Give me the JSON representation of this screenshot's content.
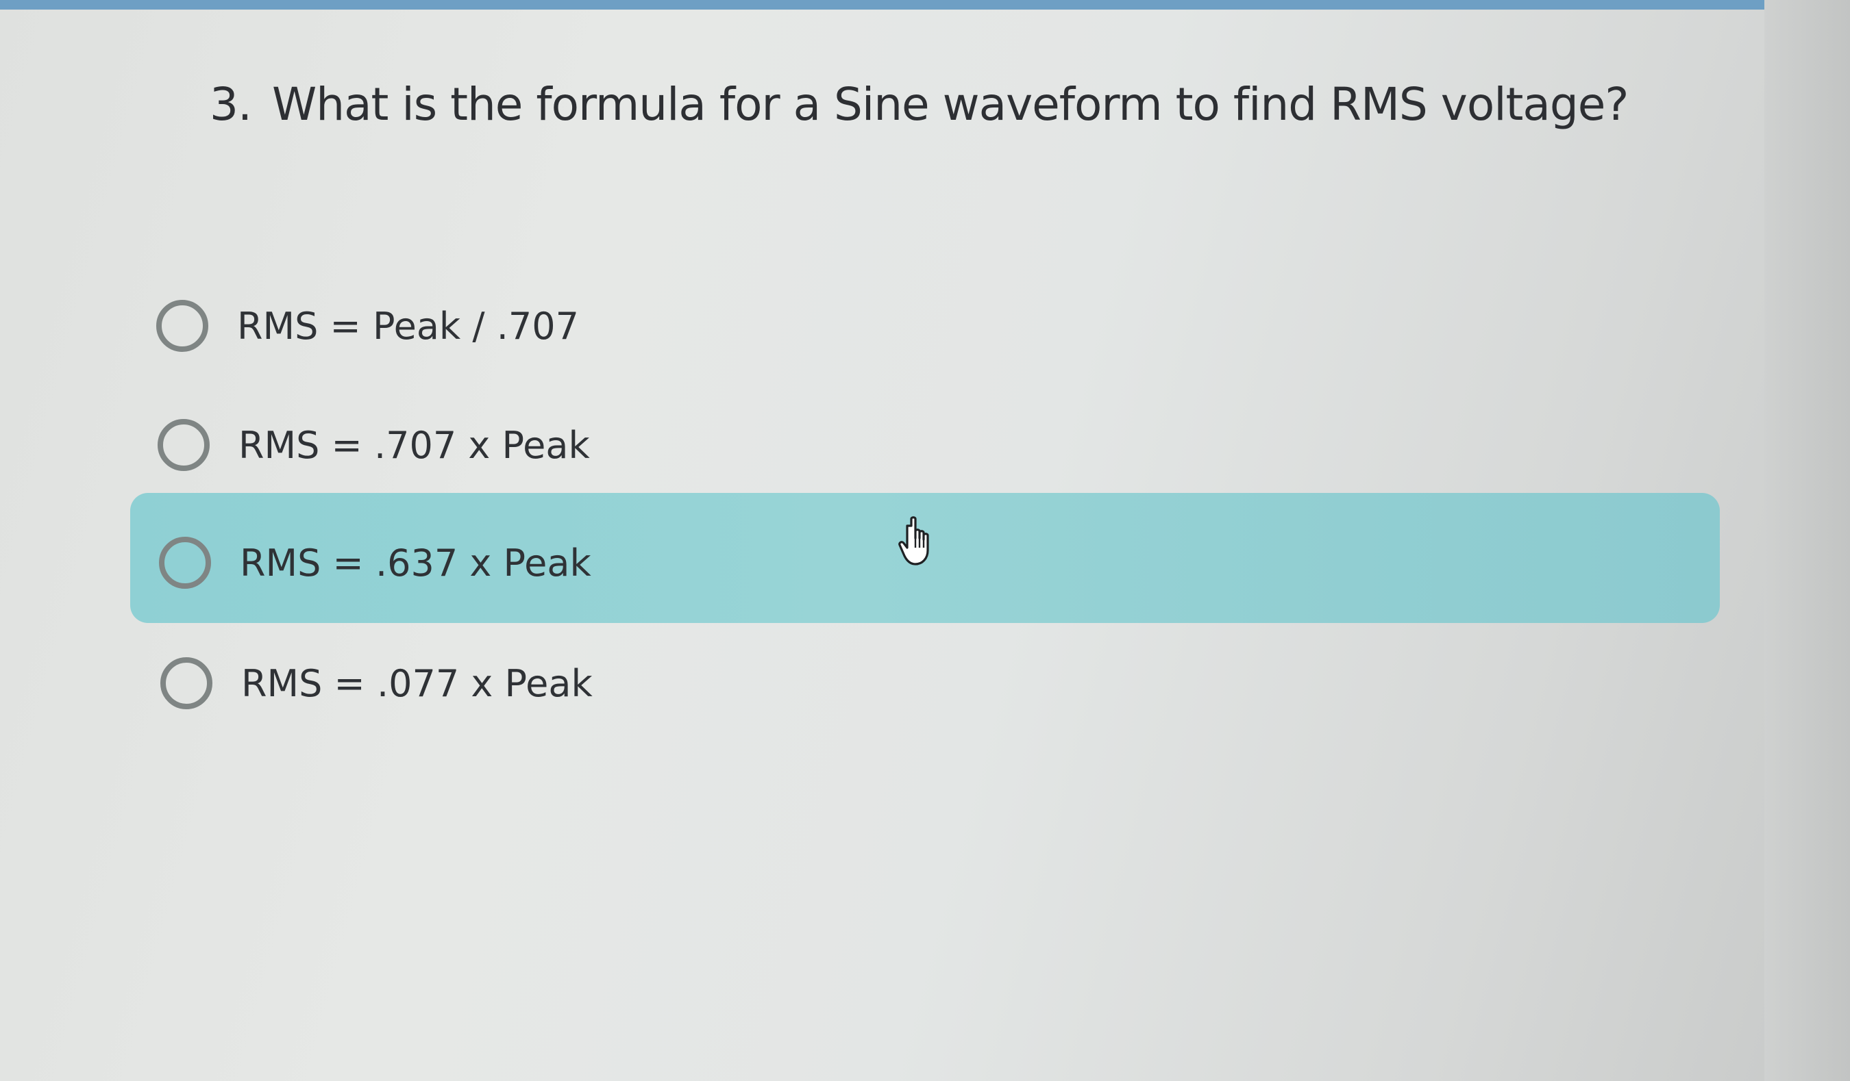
{
  "question": {
    "number": "3.",
    "text": "What is the formula for a Sine waveform to find RMS voltage?"
  },
  "options": [
    {
      "label": "RMS = Peak / .707",
      "hovered": false
    },
    {
      "label": "RMS = .707 x Peak",
      "hovered": false
    },
    {
      "label": "RMS = .637 x Peak",
      "hovered": true
    },
    {
      "label": "RMS = .077 x Peak",
      "hovered": false
    }
  ],
  "cursor": {
    "icon": "hand-pointer-icon"
  },
  "colors": {
    "top_bar": "#6e9fc4",
    "hover_highlight": "#8fd0d4",
    "radio_border": "#7f8584",
    "text": "#2d2f33"
  }
}
